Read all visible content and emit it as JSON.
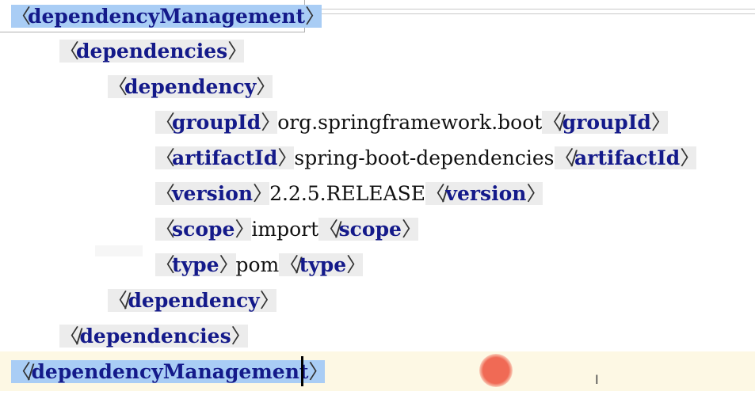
{
  "editor": {
    "lines": [
      {
        "indent": 0,
        "parts": [
          {
            "open": true,
            "tag": "dependencyManagement"
          }
        ],
        "highlight": true
      },
      {
        "indent": 1,
        "parts": [
          {
            "open": true,
            "tag": "dependencies"
          }
        ]
      },
      {
        "indent": 2,
        "parts": [
          {
            "open": true,
            "tag": "dependency"
          }
        ]
      },
      {
        "indent": 3,
        "parts": [
          {
            "open": true,
            "tag": "groupId"
          },
          {
            "text": "org.springframework.boot"
          },
          {
            "open": false,
            "tag": "groupId"
          }
        ]
      },
      {
        "indent": 3,
        "parts": [
          {
            "open": true,
            "tag": "artifactId"
          },
          {
            "text": "spring-boot-dependencies"
          },
          {
            "open": false,
            "tag": "artifactId"
          }
        ]
      },
      {
        "indent": 3,
        "parts": [
          {
            "open": true,
            "tag": "version"
          },
          {
            "text": "2.2.5.RELEASE"
          },
          {
            "open": false,
            "tag": "version"
          }
        ]
      },
      {
        "indent": 3,
        "parts": [
          {
            "open": true,
            "tag": "scope"
          },
          {
            "text": "import"
          },
          {
            "open": false,
            "tag": "scope"
          }
        ]
      },
      {
        "indent": 3,
        "parts": [
          {
            "open": true,
            "tag": "type"
          },
          {
            "text": "pom"
          },
          {
            "open": false,
            "tag": "type"
          }
        ]
      },
      {
        "indent": 2,
        "parts": [
          {
            "open": false,
            "tag": "dependency"
          }
        ]
      },
      {
        "indent": 1,
        "parts": [
          {
            "open": false,
            "tag": "dependencies"
          }
        ]
      },
      {
        "indent": 0,
        "parts": [
          {
            "open": false,
            "tag": "dependencyManagement"
          }
        ],
        "highlight": true,
        "caret": true
      }
    ]
  },
  "icons": [
    "record-indicator-icon",
    "text-cursor-icon"
  ],
  "colors": {
    "tag": "#141a8a",
    "highlight": "#a9cdf5",
    "caret_line": "#fdf8e4",
    "tag_chip": "#ececec",
    "record_dot": "#f06a55"
  }
}
